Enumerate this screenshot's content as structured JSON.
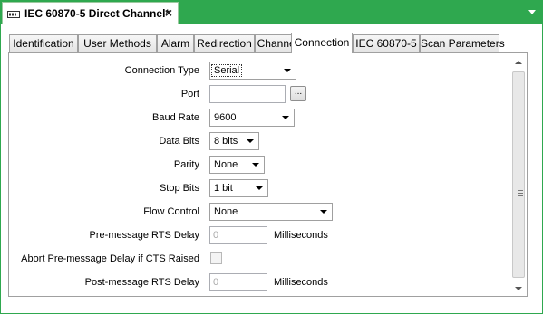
{
  "document_tab": {
    "title": "IEC 60870-5 Direct Channel*",
    "close": "×"
  },
  "tabs": [
    {
      "label": "Identification"
    },
    {
      "label": "User Methods"
    },
    {
      "label": "Alarm"
    },
    {
      "label": "Redirection"
    },
    {
      "label": "Channel"
    },
    {
      "label": "Connection",
      "active": true
    },
    {
      "label": "IEC 60870-5"
    },
    {
      "label": "Scan Parameters"
    }
  ],
  "form": {
    "connection_type": {
      "label": "Connection Type",
      "value": "Serial"
    },
    "port": {
      "label": "Port",
      "value": "",
      "browse": "..."
    },
    "baud_rate": {
      "label": "Baud Rate",
      "value": "9600"
    },
    "data_bits": {
      "label": "Data Bits",
      "value": "8 bits"
    },
    "parity": {
      "label": "Parity",
      "value": "None"
    },
    "stop_bits": {
      "label": "Stop Bits",
      "value": "1 bit"
    },
    "flow_control": {
      "label": "Flow Control",
      "value": "None"
    },
    "pre_message_rts_delay": {
      "label": "Pre-message RTS Delay",
      "value": "0",
      "unit": "Milliseconds"
    },
    "abort_pre_message_delay": {
      "label": "Abort Pre-message Delay if CTS Raised",
      "checked": false
    },
    "post_message_rts_delay": {
      "label": "Post-message RTS Delay",
      "value": "0",
      "unit": "Milliseconds"
    }
  },
  "colors": {
    "accent": "#2fa84f",
    "border": "#a0a0a0"
  }
}
